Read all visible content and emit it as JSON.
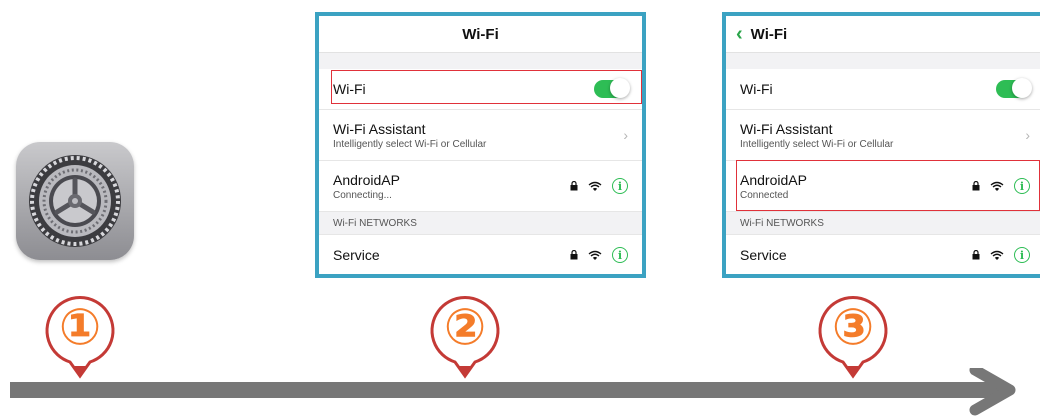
{
  "steps": [
    "①",
    "②",
    "③"
  ],
  "colors": {
    "accent": "#3ba2c2",
    "toggle": "#2ebd55",
    "highlight": "#e0313a",
    "pin": "#c43a36",
    "step_number": "#f47c2a",
    "arrow": "#777777"
  },
  "settings_icon": {
    "icon": "gear-icon"
  },
  "panel2": {
    "nav_title": "Wi-Fi",
    "wifi_label": "Wi-Fi",
    "assistant_title": "Wi-Fi Assistant",
    "assistant_sub": "Intelligently select Wi-Fi or Cellular",
    "network_name": "AndroidAP",
    "network_status": "Connecting...",
    "section": "Wi-Fi NETWORKS",
    "other_network": "Service",
    "info_glyph": "i",
    "chevron": "›"
  },
  "panel3": {
    "back_glyph": "‹",
    "nav_title": "Wi-Fi",
    "wifi_label": "Wi-Fi",
    "assistant_title": "Wi-Fi Assistant",
    "assistant_sub": "Intelligently select Wi-Fi or Cellular",
    "network_name": "AndroidAP",
    "network_status": "Connected",
    "section": "Wi-Fi NETWORKS",
    "other_network": "Service",
    "info_glyph": "i",
    "chevron": "›"
  }
}
